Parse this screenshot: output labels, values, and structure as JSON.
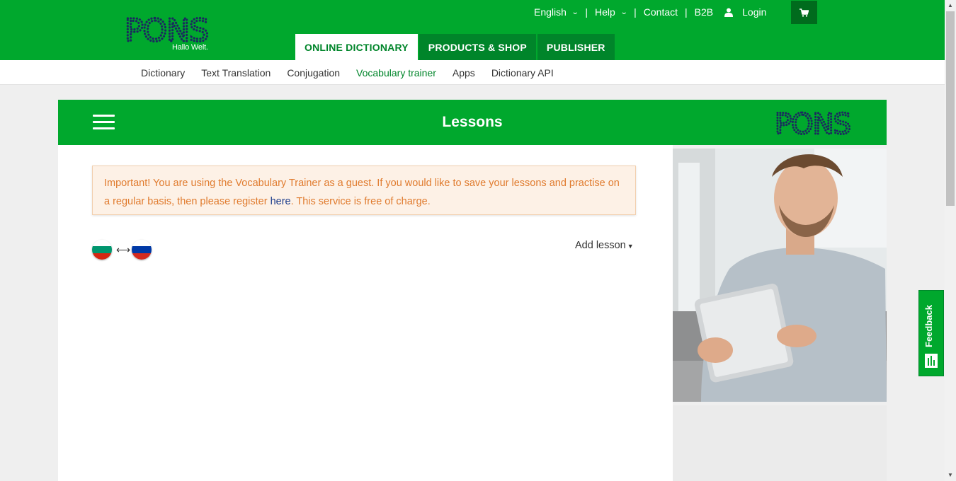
{
  "header": {
    "logo_text": "PONS",
    "tagline": "Hallo Welt.",
    "language": "English",
    "help": "Help",
    "contact": "Contact",
    "b2b": "B2B",
    "login": "Login",
    "separator": "|",
    "tabs": [
      {
        "label": "ONLINE DICTIONARY",
        "active": true
      },
      {
        "label": "PRODUCTS & SHOP",
        "active": false
      },
      {
        "label": "PUBLISHER",
        "active": false
      }
    ]
  },
  "subnav": [
    {
      "label": "Dictionary",
      "active": false
    },
    {
      "label": "Text Translation",
      "active": false
    },
    {
      "label": "Conjugation",
      "active": false
    },
    {
      "label": "Vocabulary trainer",
      "active": true
    },
    {
      "label": "Apps",
      "active": false
    },
    {
      "label": "Dictionary API",
      "active": false
    }
  ],
  "panel": {
    "title": "Lessons",
    "logo_text": "PONS"
  },
  "alert": {
    "text_before": "Important! You are using the Vocabulary Trainer as a guest. If you would like to save your lessons and practise on a regular basis, then please register ",
    "link": "here",
    "text_after": ". This service is free of charge."
  },
  "lesson": {
    "source_flag": "bulgarian-flag",
    "target_flag": "russian-flag",
    "arrow": "⟷",
    "add_lesson": "Add lesson"
  },
  "feedback": {
    "label": "Feedback"
  },
  "colors": {
    "brand_green": "#00a82d",
    "dark_green": "#00852a",
    "logo_navy": "#1a2a5e",
    "alert_text": "#e07b2e",
    "alert_bg": "#fdf1e6"
  }
}
